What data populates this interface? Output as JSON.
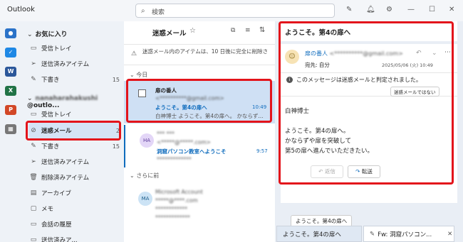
{
  "app": {
    "title": "Outlook"
  },
  "search": {
    "icon": "search-icon",
    "placeholder": "検索"
  },
  "favorites": {
    "title": "お気に入り",
    "items": [
      {
        "label": "受信トレイ",
        "icon": "inbox-icon",
        "count": ""
      },
      {
        "label": "送信済みアイテム",
        "icon": "send-icon",
        "count": ""
      },
      {
        "label": "下書き",
        "icon": "draft-icon",
        "count": "15"
      }
    ]
  },
  "account": {
    "name": " @outlo...",
    "items": [
      {
        "label": "受信トレイ",
        "icon": "inbox-icon",
        "count": ""
      },
      {
        "label": "迷惑メール",
        "icon": "junk-icon",
        "count": "2"
      },
      {
        "label": "下書き",
        "icon": "draft-icon",
        "count": "15"
      },
      {
        "label": "送信済みアイテム",
        "icon": "send-icon",
        "count": ""
      },
      {
        "label": "削除済みアイテム",
        "icon": "trash-icon",
        "count": ""
      },
      {
        "label": "アーカイブ",
        "icon": "archive-icon",
        "count": ""
      },
      {
        "label": "メモ",
        "icon": "note-icon",
        "count": ""
      },
      {
        "label": "会話の履歴",
        "icon": "folder-icon",
        "count": ""
      },
      {
        "label": "送信済みア...",
        "icon": "folder-icon",
        "count": ""
      }
    ]
  },
  "list": {
    "title": "迷惑メール",
    "notice": "迷惑メール内のアイテムは、10 日後に完全に削除さ",
    "group_today": "今日",
    "group_earlier": "さらに前",
    "messages": [
      {
        "sender": "扉の番人",
        "email": "<**********@gmail.com>",
        "subject": "ようこそ。第4の扉へ",
        "time": "10:49",
        "preview": "白神博士 ようこそ。第4の扉へ。 かならず..."
      },
      {
        "avatar": "HA",
        "sender": "*** ***",
        "email": "<*****@*****.com>",
        "subject": "洞窟パソコン教室へようこそ",
        "time": "9:57",
        "preview": "*************"
      },
      {
        "avatar": "MA",
        "sender": "Microsoft Account",
        "email": "*****@****.com",
        "subject": "************",
        "time": "",
        "preview": "*************"
      }
    ]
  },
  "reader": {
    "subject": "ようこそ。第4の扉へ",
    "from_name": "扉の番人",
    "from_email": "<**********@gmail.com>",
    "to_label": "宛先:",
    "to_value": "自分",
    "date": "2025/05/06 (火) 10:49",
    "junk_notice": "このメッセージは迷惑メールと判定されました。",
    "not_junk_button": "迷惑メールではない",
    "body": [
      "白神博士",
      "ようこそ。第4の扉へ。",
      "かならずや扉を突破して",
      "第5の扉へ進んでいただきたい。"
    ],
    "reply_button": "返信",
    "forward_button": "転送"
  },
  "tooltip": "ようこそ。第4の扉へ",
  "bottom_tabs": [
    {
      "label": "ようこそ。第4の扉へ"
    },
    {
      "label": "Fw: 洞窟パソコン..."
    }
  ],
  "colors": {
    "accent": "#0f6cbd",
    "highlight": "#e3141b",
    "selected": "#d5e3f5"
  }
}
